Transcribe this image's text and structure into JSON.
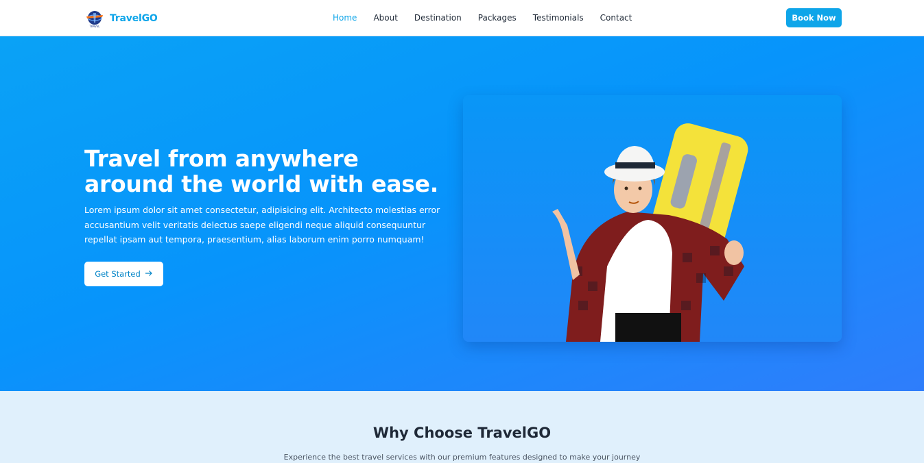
{
  "brand": {
    "name": "TravelGO",
    "logo_icon": "globe-plane-logo"
  },
  "nav": {
    "items": [
      {
        "label": "Home",
        "active": true
      },
      {
        "label": "About",
        "active": false
      },
      {
        "label": "Destination",
        "active": false
      },
      {
        "label": "Packages",
        "active": false
      },
      {
        "label": "Testimonials",
        "active": false
      },
      {
        "label": "Contact",
        "active": false
      }
    ],
    "book_label": "Book Now"
  },
  "hero": {
    "title": "Travel from anywhere around the world with ease.",
    "description": "Lorem ipsum dolor sit amet consectetur, adipisicing elit. Architecto molestias error accusantium velit veritatis delectus saepe eligendi neque aliquid consequuntur repellat ipsam aut tempora, praesentium, alias laborum enim porro numquam!",
    "cta_label": "Get Started",
    "cta_icon": "arrow-right-icon",
    "image": "traveler-with-yellow-suitcase"
  },
  "why": {
    "title": "Why Choose TravelGO",
    "description": "Experience the best travel services with our premium features designed to make your journey"
  },
  "colors": {
    "accent": "#0ea5e9",
    "hero_start": "#0aa2f6",
    "hero_end": "#2f7dfb",
    "section_bg": "#e0f0fc"
  }
}
